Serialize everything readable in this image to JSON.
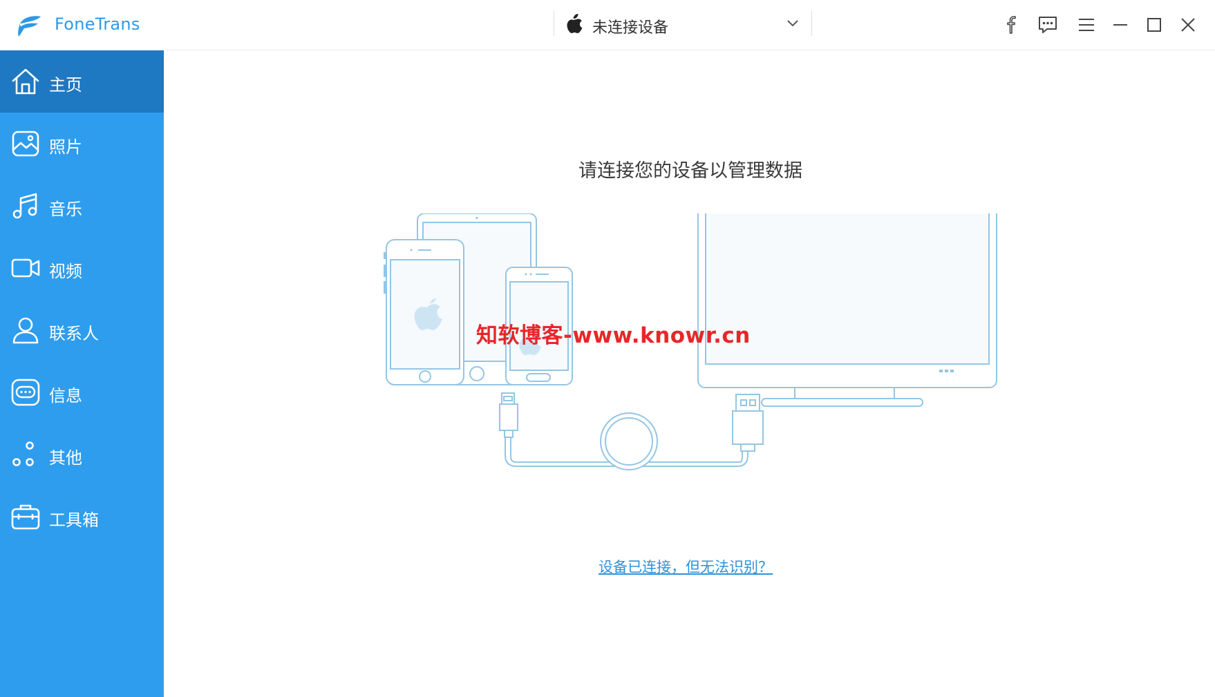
{
  "app": {
    "name": "FoneTrans",
    "accent": "#2f9ded",
    "accent_dark": "#1f78c2"
  },
  "device_selector": {
    "label": "未连接设备",
    "icon": "apple-icon"
  },
  "window_controls": [
    {
      "name": "facebook-icon"
    },
    {
      "name": "feedback-icon"
    },
    {
      "name": "menu-icon"
    },
    {
      "name": "minimize-icon"
    },
    {
      "name": "maximize-icon"
    },
    {
      "name": "close-icon"
    }
  ],
  "sidebar": {
    "items": [
      {
        "label": "主页",
        "icon": "home-icon",
        "active": true
      },
      {
        "label": "照片",
        "icon": "photo-icon"
      },
      {
        "label": "音乐",
        "icon": "music-icon"
      },
      {
        "label": "视频",
        "icon": "video-icon"
      },
      {
        "label": "联系人",
        "icon": "contacts-icon"
      },
      {
        "label": "信息",
        "icon": "message-icon"
      },
      {
        "label": "其他",
        "icon": "other-icon"
      },
      {
        "label": "工具箱",
        "icon": "toolbox-icon"
      }
    ]
  },
  "main": {
    "headline": "请连接您的设备以管理数据",
    "watermark": "知软博客-www.knowr.cn",
    "help_link": "设备已连接，但无法识别？"
  }
}
